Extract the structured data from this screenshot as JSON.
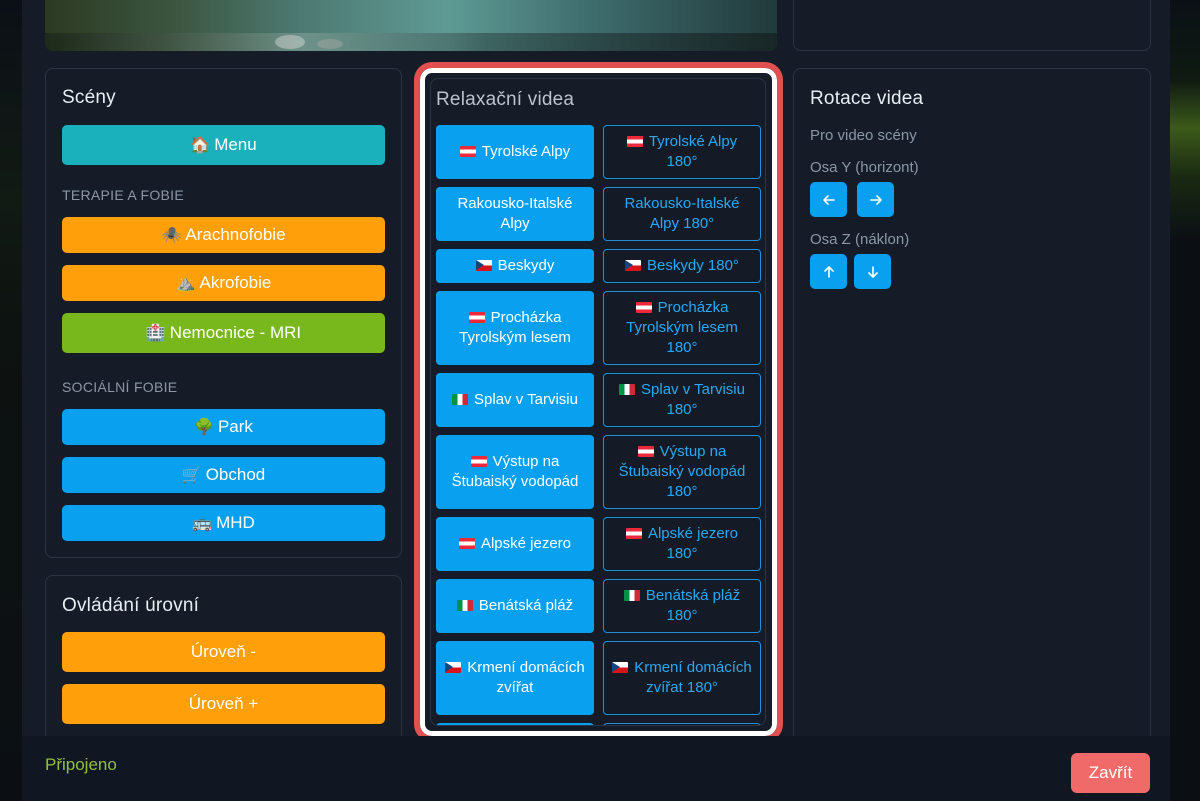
{
  "scenes": {
    "title": "Scény",
    "menu_button": {
      "icon": "house-emoji",
      "emoji": "🏠",
      "label": "Menu"
    },
    "therapy_section": "TERAPIE A FOBIE",
    "therapy_buttons": [
      {
        "emoji": "🕷️",
        "icon": "spider-emoji",
        "label": "Arachnofobie"
      },
      {
        "emoji": "⛰️",
        "icon": "mountain-emoji",
        "label": "Akrofobie"
      },
      {
        "emoji": "🏥",
        "icon": "hospital-emoji",
        "label": "Nemocnice - MRI"
      }
    ],
    "social_section": "SOCIÁLNÍ FOBIE",
    "social_buttons": [
      {
        "emoji": "🌳",
        "icon": "tree-emoji",
        "label": "Park"
      },
      {
        "emoji": "🛒",
        "icon": "cart-emoji",
        "label": "Obchod"
      },
      {
        "emoji": "🚌",
        "icon": "bus-emoji",
        "label": "MHD"
      }
    ]
  },
  "levels": {
    "title": "Ovládání úrovní",
    "decrease_label": "Úroveň -",
    "increase_label": "Úroveň +"
  },
  "videos": {
    "title": "Relaxační videa",
    "rows": [
      {
        "flag": "at",
        "label": "Tyrolské Alpy",
        "label180": "Tyrolské Alpy 180°"
      },
      {
        "flag": "",
        "label": "Rakousko-Italské Alpy",
        "label180": "Rakousko-Italské Alpy 180°"
      },
      {
        "flag": "cz",
        "label": "Beskydy",
        "label180": "Beskydy 180°"
      },
      {
        "flag": "at",
        "label": "Procházka Tyrolským lesem",
        "label180": "Procházka Tyrolským lesem 180°"
      },
      {
        "flag": "it",
        "label": "Splav v Tarvisiu",
        "label180": "Splav v Tarvisiu 180°"
      },
      {
        "flag": "at",
        "label": "Výstup na Štubaiský vodopád",
        "label180": "Výstup na Štubaiský vodopád 180°"
      },
      {
        "flag": "at",
        "label": "Alpské jezero",
        "label180": "Alpské jezero 180°"
      },
      {
        "flag": "it",
        "label": "Benátská pláž",
        "label180": "Benátská pláž 180°"
      },
      {
        "flag": "cz",
        "label": "Krmení domácích zvířat",
        "label180": "Krmení domácích zvířat 180°"
      }
    ]
  },
  "rotation": {
    "title": "Rotace videa",
    "subtitle": "Pro video scény",
    "axis_y": "Osa Y (horizont)",
    "axis_z": "Osa Z (náklon)"
  },
  "footer": {
    "status": "Připojeno",
    "close_label": "Zavřít"
  },
  "colors": {
    "accent_blue": "#0aa0f0",
    "orange": "#ff9f0a",
    "teal": "#1ab0bc",
    "green": "#78b81c",
    "close_red": "#f06a6a",
    "highlight": "#e05050"
  }
}
